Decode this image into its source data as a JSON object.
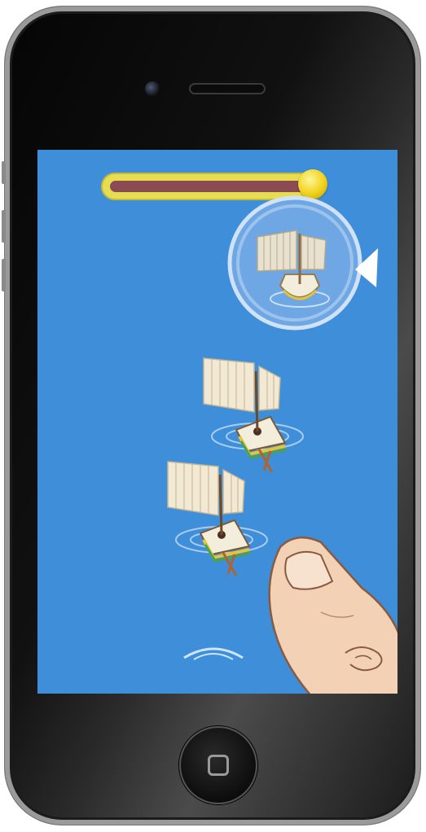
{
  "device": {
    "model_icon": "iphone-4-frame",
    "screen_color": "#3f8ed9"
  },
  "progress": {
    "fraction": 0.98,
    "track_color": "#e7dd52",
    "fill_color": "#8c4a52",
    "knob_color": "#f1d21a"
  },
  "preview": {
    "icon": "ship-icon",
    "arrow_icon": "play-arrow-icon"
  },
  "ships": [
    {
      "icon": "sailing-ship-icon"
    },
    {
      "icon": "sailing-ship-icon"
    }
  ],
  "tutorial": {
    "icon": "finger-tap-icon",
    "swipe_icon": "swipe-up-chevron-icon"
  },
  "home_button": {
    "icon": "home-square-icon"
  }
}
